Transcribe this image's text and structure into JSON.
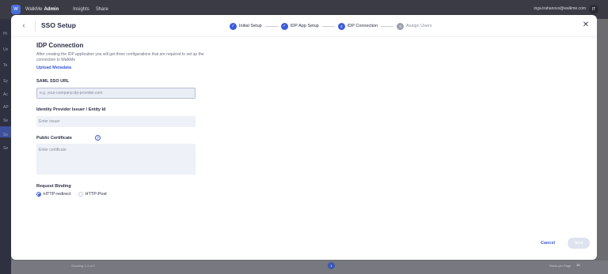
{
  "background": {
    "brand": "WalkMe",
    "brand_suffix": "Admin",
    "nav": [
      "Insights",
      "Share"
    ],
    "user_email": "inga.trahanovs@walkme.com",
    "avatar_initials": "IT",
    "side_items": [
      "Hi",
      "Us",
      "Te",
      "Sy",
      "Ac",
      "AP",
      "Se",
      "Ss",
      "Se"
    ],
    "showing_text": "Showing 1-1 of 1",
    "page_number": "1",
    "rows_per_page_label": "Rows per Page",
    "rows_per_page_value": "10"
  },
  "modal": {
    "title": "SSO Setup",
    "back_icon": "chevron-left-icon",
    "close_icon": "close-icon",
    "steps": [
      {
        "label": "Initial Setup",
        "state": "done",
        "marker": "✓"
      },
      {
        "label": "IDP App Setup",
        "state": "done",
        "marker": "✓"
      },
      {
        "label": "IDP Connection",
        "state": "current",
        "marker": "3"
      },
      {
        "label": "Assign Users",
        "state": "todo",
        "marker": "4"
      }
    ],
    "section_title": "IDP Connection",
    "section_description": "After creating the IDP application you will get three configurations that are required to set up the connection to WalkMe",
    "upload_link": "Upload Metadata",
    "fields": {
      "saml_url": {
        "label": "SAML SSO URL",
        "placeholder": "e.g. your-company.idp-provider.com"
      },
      "issuer": {
        "label": "Identity Provider Issuer / Entity Id",
        "placeholder": "Enter issuer"
      },
      "certificate": {
        "label": "Public Certificate",
        "placeholder": "Enter certificate",
        "help_icon": "question-icon"
      }
    },
    "request_binding": {
      "label": "Request Binding",
      "options": [
        {
          "label": "HTTP-redirect",
          "checked": true
        },
        {
          "label": "HTTP-Post",
          "checked": false
        }
      ]
    },
    "footer": {
      "cancel": "Cancel",
      "next": "Next"
    }
  },
  "colors": {
    "accent": "#3c5cd9",
    "overlay": "#6b6b70",
    "input_bg": "#eef1f7",
    "disabled_btn": "#dfe3ef"
  }
}
